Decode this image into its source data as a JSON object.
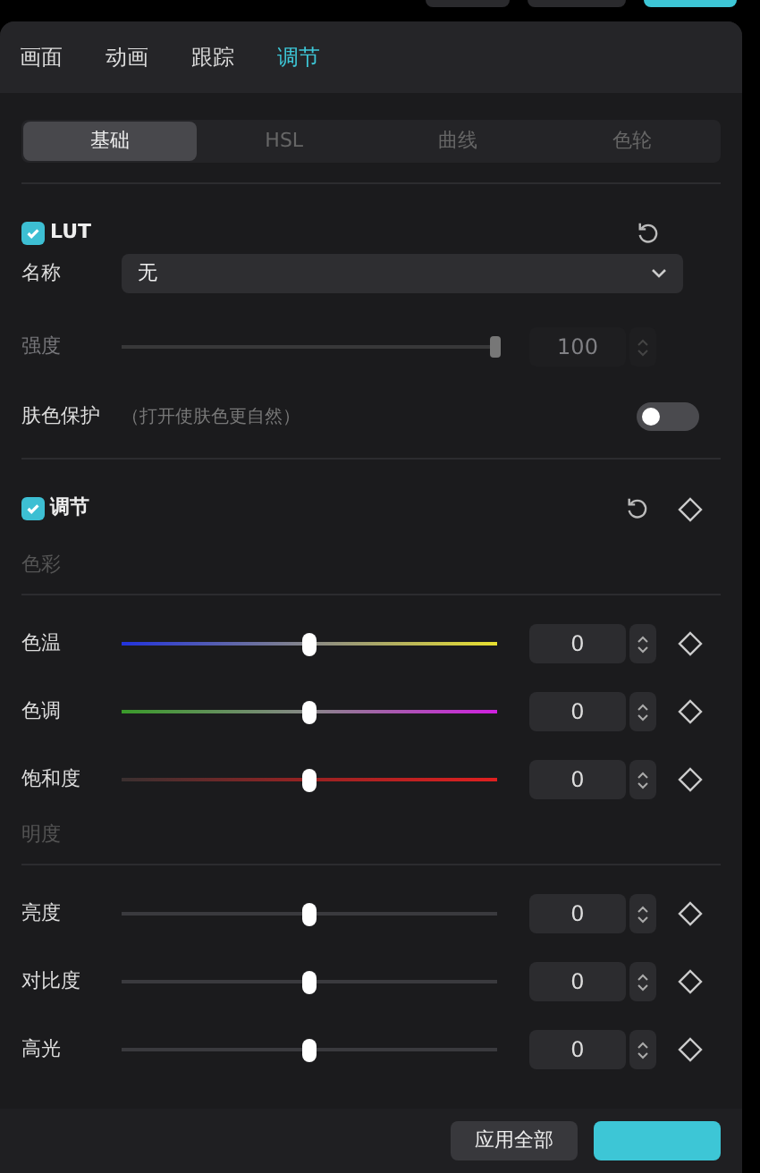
{
  "top_tabs": [
    {
      "label": "画面",
      "selected": false
    },
    {
      "label": "动画",
      "selected": false
    },
    {
      "label": "跟踪",
      "selected": false
    },
    {
      "label": "调节",
      "selected": true
    }
  ],
  "sub_tabs": [
    {
      "label": "基础",
      "selected": true
    },
    {
      "label": "HSL",
      "selected": false
    },
    {
      "label": "曲线",
      "selected": false
    },
    {
      "label": "色轮",
      "selected": false
    }
  ],
  "lut": {
    "title": "LUT",
    "checked": true,
    "name_label": "名称",
    "name_value": "无",
    "strength": {
      "label": "强度",
      "level": 1,
      "value": "100",
      "disabled": true
    },
    "skin_label": "肤色保护",
    "skin_hint": "（打开使肤色更自然）",
    "skin_on": false
  },
  "adjust": {
    "title": "调节",
    "checked": true,
    "groups": [
      {
        "label": "色彩",
        "rows": [
          {
            "label": "色温",
            "kind": "temperature",
            "level": 0.5,
            "value": "0"
          },
          {
            "label": "色调",
            "kind": "tint",
            "level": 0.5,
            "value": "0"
          },
          {
            "label": "饱和度",
            "kind": "saturation",
            "level": 0.5,
            "value": "0"
          }
        ]
      },
      {
        "label": "明度",
        "rows": [
          {
            "label": "亮度",
            "kind": "plain",
            "level": 0.5,
            "value": "0"
          },
          {
            "label": "对比度",
            "kind": "plain",
            "level": 0.5,
            "value": "0"
          },
          {
            "label": "高光",
            "kind": "plain",
            "level": 0.5,
            "value": "0"
          }
        ]
      }
    ]
  },
  "footer": {
    "apply_all": "应用全部"
  }
}
